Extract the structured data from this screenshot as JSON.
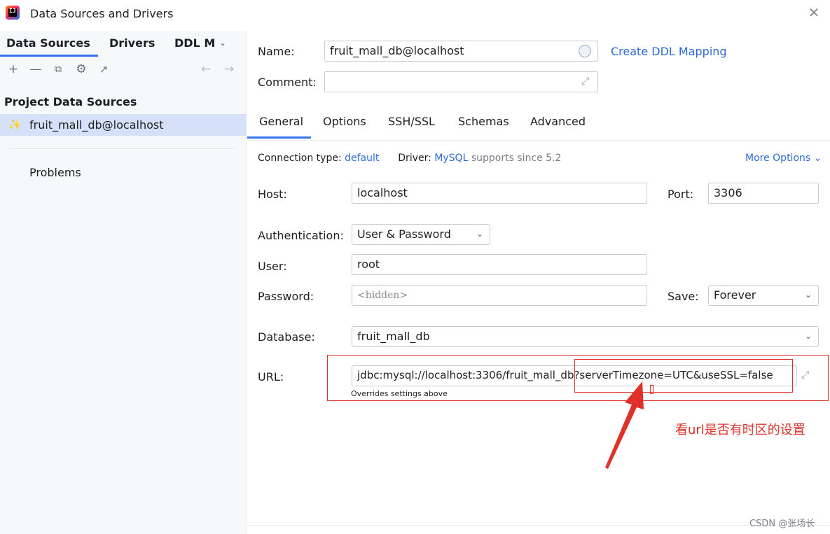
{
  "window": {
    "title": "Data Sources and Drivers",
    "close_icon": "close-icon"
  },
  "left": {
    "tabs": [
      {
        "label": "Data Sources",
        "active": true
      },
      {
        "label": "Drivers",
        "active": false
      },
      {
        "label": "DDL M",
        "active": false
      }
    ],
    "toolbar": [
      "add-icon",
      "remove-icon",
      "duplicate-icon",
      "settings-icon",
      "jump-to-icon",
      "back-icon",
      "forward-icon"
    ],
    "section_title": "Project Data Sources",
    "data_source": "fruit_mall_db@localhost",
    "problems": "Problems"
  },
  "right": {
    "name_label": "Name:",
    "name_value": "fruit_mall_db@localhost",
    "create_ddl": "Create DDL Mapping",
    "comment_label": "Comment:",
    "comment_value": "",
    "tabs": [
      {
        "label": "General",
        "active": true
      },
      {
        "label": "Options",
        "active": false
      },
      {
        "label": "SSH/SSL",
        "active": false
      },
      {
        "label": "Schemas",
        "active": false
      },
      {
        "label": "Advanced",
        "active": false
      }
    ],
    "conn_type_label": "Connection type:",
    "conn_type_value": "default",
    "driver_label": "Driver:",
    "driver_value": "MySQL",
    "driver_note": "supports since 5.2",
    "more_options": "More Options",
    "host_label": "Host:",
    "host_value": "localhost",
    "port_label": "Port:",
    "port_value": "3306",
    "auth_label": "Authentication:",
    "auth_value": "User & Password",
    "user_label": "User:",
    "user_value": "root",
    "password_label": "Password:",
    "password_placeholder": "<hidden>",
    "save_label": "Save:",
    "save_value": "Forever",
    "database_label": "Database:",
    "database_value": "fruit_mall_db",
    "url_label": "URL:",
    "url_value": "jdbc:mysql://localhost:3306/fruit_mall_db?serverTimezone=UTC&useSSL=false",
    "url_note": "Overrides settings above"
  },
  "annotation": {
    "text": "看url是否有时区的设置",
    "color": "#e0302a"
  },
  "watermark": "CSDN @张场长",
  "colors": {
    "accent": "#3574f0",
    "link": "#2f6bd8",
    "selection": "#d5e1f8"
  }
}
